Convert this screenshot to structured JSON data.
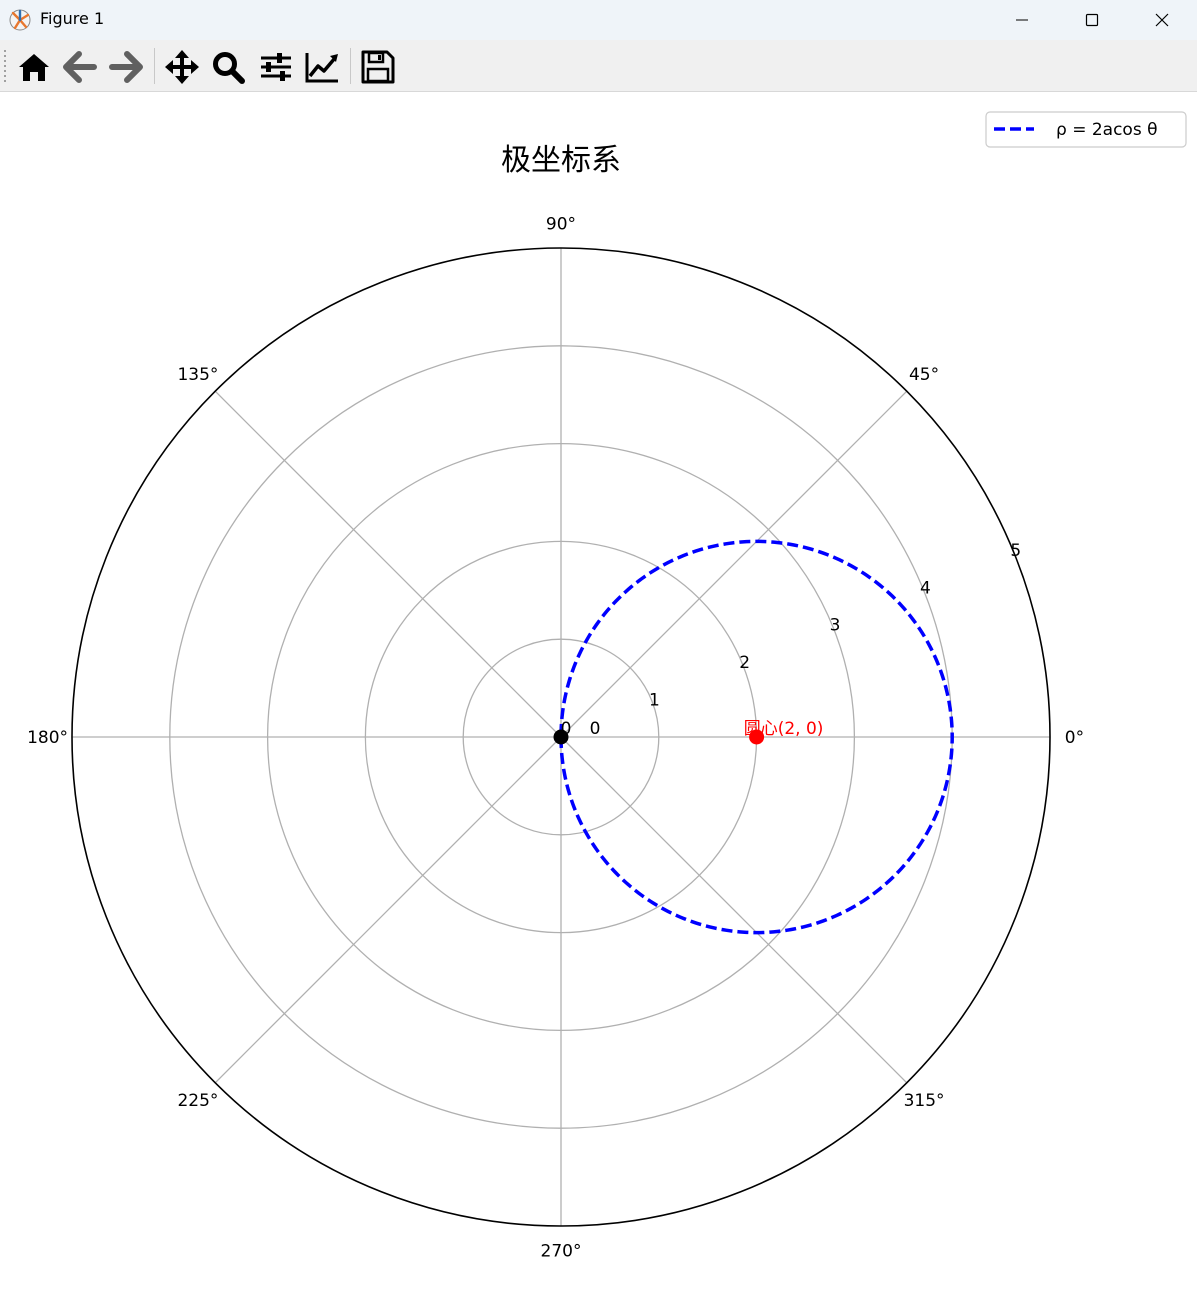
{
  "window": {
    "title": "Figure 1",
    "controls": [
      "minimize",
      "maximize",
      "close"
    ]
  },
  "toolbar": {
    "buttons": [
      {
        "name": "home",
        "icon": "home-icon"
      },
      {
        "name": "back",
        "icon": "arrow-left-icon"
      },
      {
        "name": "forward",
        "icon": "arrow-right-icon"
      },
      {
        "name": "pan",
        "icon": "move-icon"
      },
      {
        "name": "zoom",
        "icon": "magnifier-icon"
      },
      {
        "name": "configure-subplots",
        "icon": "sliders-icon"
      },
      {
        "name": "edit-axis",
        "icon": "line-chart-icon"
      },
      {
        "name": "save",
        "icon": "floppy-disk-icon"
      }
    ]
  },
  "chart_data": {
    "type": "polar-line",
    "title": "极坐标系",
    "theta_ticks": [
      {
        "deg": 0,
        "label": "0°"
      },
      {
        "deg": 45,
        "label": "45°"
      },
      {
        "deg": 90,
        "label": "90°"
      },
      {
        "deg": 135,
        "label": "135°"
      },
      {
        "deg": 180,
        "label": "180°"
      },
      {
        "deg": 225,
        "label": "225°"
      },
      {
        "deg": 270,
        "label": "270°"
      },
      {
        "deg": 315,
        "label": "315°"
      }
    ],
    "r_ticks": [
      {
        "r": 0,
        "label": "0"
      },
      {
        "r": 1,
        "label": "1"
      },
      {
        "r": 2,
        "label": "2"
      },
      {
        "r": 3,
        "label": "3"
      },
      {
        "r": 4,
        "label": "4"
      },
      {
        "r": 5,
        "label": "5"
      }
    ],
    "r_label_angle_deg": 22.5,
    "rlim": [
      0,
      5
    ],
    "grid": true,
    "series": [
      {
        "name": "ρ = 2acos θ",
        "equation": "rho = 4*cos(theta)",
        "a": 2,
        "theta_range_deg": [
          -90,
          90
        ],
        "color": "#0000ff",
        "linestyle": "dashed"
      }
    ],
    "points": [
      {
        "r": 0,
        "theta_deg": 0,
        "label": "0",
        "color": "#000000"
      },
      {
        "r": 2,
        "theta_deg": 0,
        "label": "圆心(2, 0)",
        "color": "#ff0000"
      }
    ],
    "legend": {
      "placement": "top-right",
      "entries": [
        "ρ = 2acos θ"
      ]
    }
  }
}
